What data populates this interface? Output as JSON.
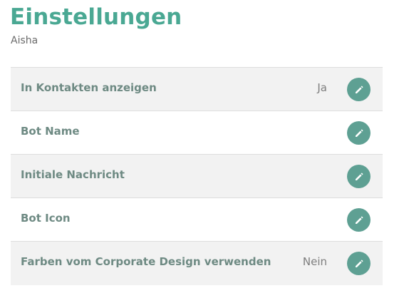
{
  "header": {
    "title": "Einstellungen",
    "subtitle": "Aisha"
  },
  "accent_color": "#4aa893",
  "button_color": "#5ea093",
  "settings": [
    {
      "label": "In Kontakten anzeigen",
      "value": "Ja",
      "action_icon": "pencil-icon"
    },
    {
      "label": "Bot Name",
      "value": "",
      "action_icon": "pencil-icon"
    },
    {
      "label": "Initiale Nachricht",
      "value": "",
      "action_icon": "pencil-icon"
    },
    {
      "label": "Bot Icon",
      "value": "",
      "action_icon": "pencil-icon"
    },
    {
      "label": "Farben vom Corporate Design verwenden",
      "value": "Nein",
      "action_icon": "pencil-icon"
    }
  ]
}
